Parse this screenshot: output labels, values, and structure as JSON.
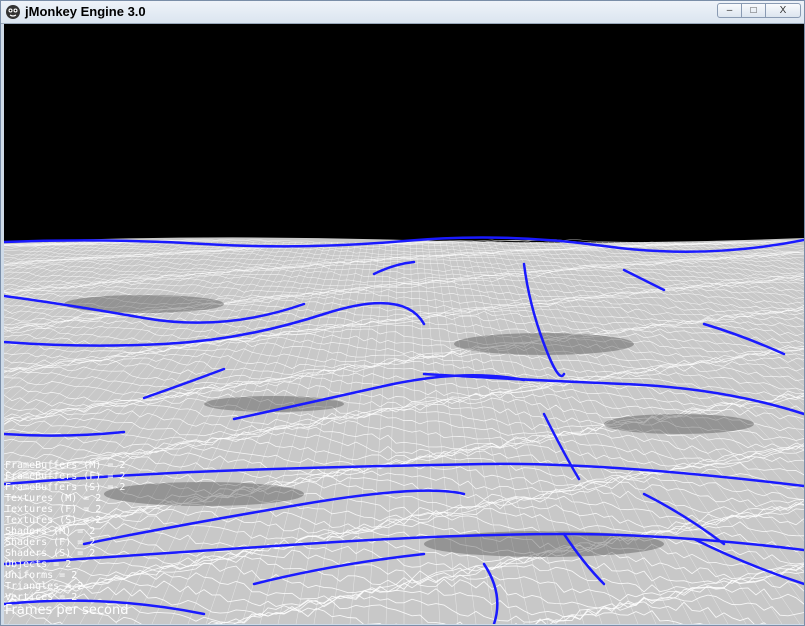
{
  "window": {
    "title": "jMonkey Engine 3.0",
    "controls": {
      "minimize": "–",
      "maximize": "□",
      "close": "X"
    }
  },
  "scene": {
    "background_color": "#000000",
    "terrain_fill": "#c8c8c8",
    "wire_color": "#ffffff",
    "ridge_color": "#1a1aff"
  },
  "stats": [
    "FrameBuffers (M) = 2",
    "FrameBuffers (F) = 2",
    "FrameBuffers (S) = 2",
    "Textures (M) = 2",
    "Textures (F) = 2",
    "Textures (S) = 2",
    "Shaders (M) = 2",
    "Shaders (F) = 2",
    "Shaders (S) = 2",
    "Objects = 2",
    "Uniforms = 2",
    "Triangles = 2",
    "Vertices = 2"
  ],
  "fps_label": "Frames per second"
}
